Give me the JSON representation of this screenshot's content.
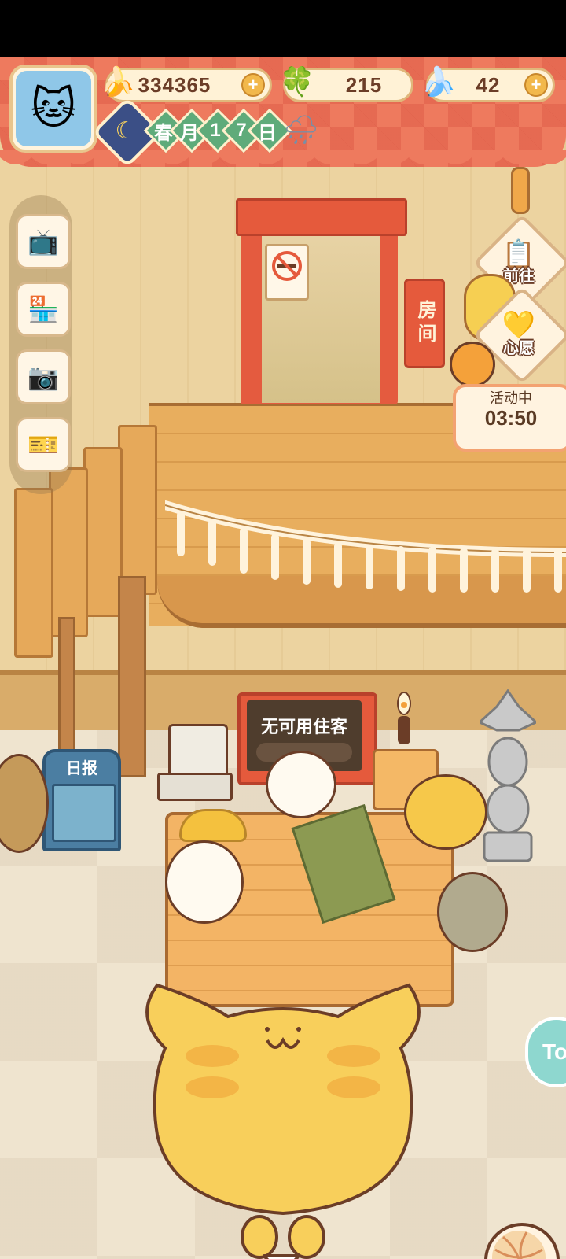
{
  "hud": {
    "bananas": "334365",
    "clovers": "215",
    "blue_bananas": "42",
    "date": {
      "season": "春",
      "month_label": "月",
      "day_digit_1": "1",
      "day_digit_2": "7",
      "day_label": "日"
    }
  },
  "scene": {
    "door_sign": "房间",
    "desk_screen": "无可用住客",
    "newspaper_label": "日报"
  },
  "right_buttons": {
    "goto_label": "前往",
    "wish_label": "心愿"
  },
  "event": {
    "label": "活动中",
    "timer": "03:50"
  },
  "side_buttons": [
    "tv-icon",
    "shop-icon",
    "camera-icon",
    "ticket-icon"
  ],
  "partial_button": "To",
  "colors": {
    "hud_red": "#ee7a5e",
    "accent_orange": "#f2b84b",
    "door_red": "#e55a3c",
    "text_brown": "#6b3d27"
  }
}
